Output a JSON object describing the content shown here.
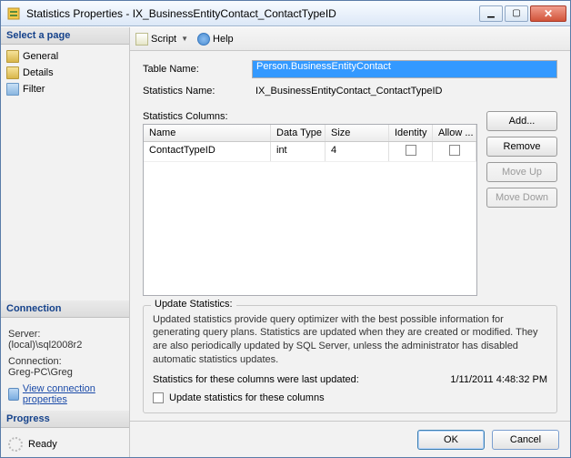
{
  "window": {
    "title": "Statistics Properties - IX_BusinessEntityContact_ContactTypeID"
  },
  "left": {
    "select_header": "Select a page",
    "pages": {
      "general": "General",
      "details": "Details",
      "filter": "Filter"
    },
    "connection_header": "Connection",
    "server_label": "Server:",
    "server_value": "(local)\\sql2008r2",
    "connection_label": "Connection:",
    "connection_value": "Greg-PC\\Greg",
    "view_conn": "View connection properties",
    "progress_header": "Progress",
    "progress_status": "Ready"
  },
  "toolbar": {
    "script": "Script",
    "help": "Help"
  },
  "form": {
    "table_label": "Table Name:",
    "table_value": "Person.BusinessEntityContact",
    "stat_label": "Statistics Name:",
    "stat_value": "IX_BusinessEntityContact_ContactTypeID",
    "cols_label": "Statistics Columns:"
  },
  "grid": {
    "headers": {
      "name": "Name",
      "type": "Data Type",
      "size": "Size",
      "identity": "Identity",
      "allow": "Allow ..."
    },
    "row": {
      "name": "ContactTypeID",
      "type": "int",
      "size": "4"
    }
  },
  "buttons": {
    "add": "Add...",
    "remove": "Remove",
    "up": "Move Up",
    "down": "Move Down"
  },
  "update": {
    "legend": "Update Statistics:",
    "desc": "Updated statistics provide query optimizer with the best possible information for generating query plans. Statistics are updated when they are created or modified. They are also periodically updated by SQL Server, unless the administrator has disabled automatic statistics updates.",
    "last_label": "Statistics for these columns were last updated:",
    "last_value": "1/11/2011 4:48:32 PM",
    "checkbox": "Update statistics for these columns"
  },
  "footer": {
    "ok": "OK",
    "cancel": "Cancel"
  }
}
